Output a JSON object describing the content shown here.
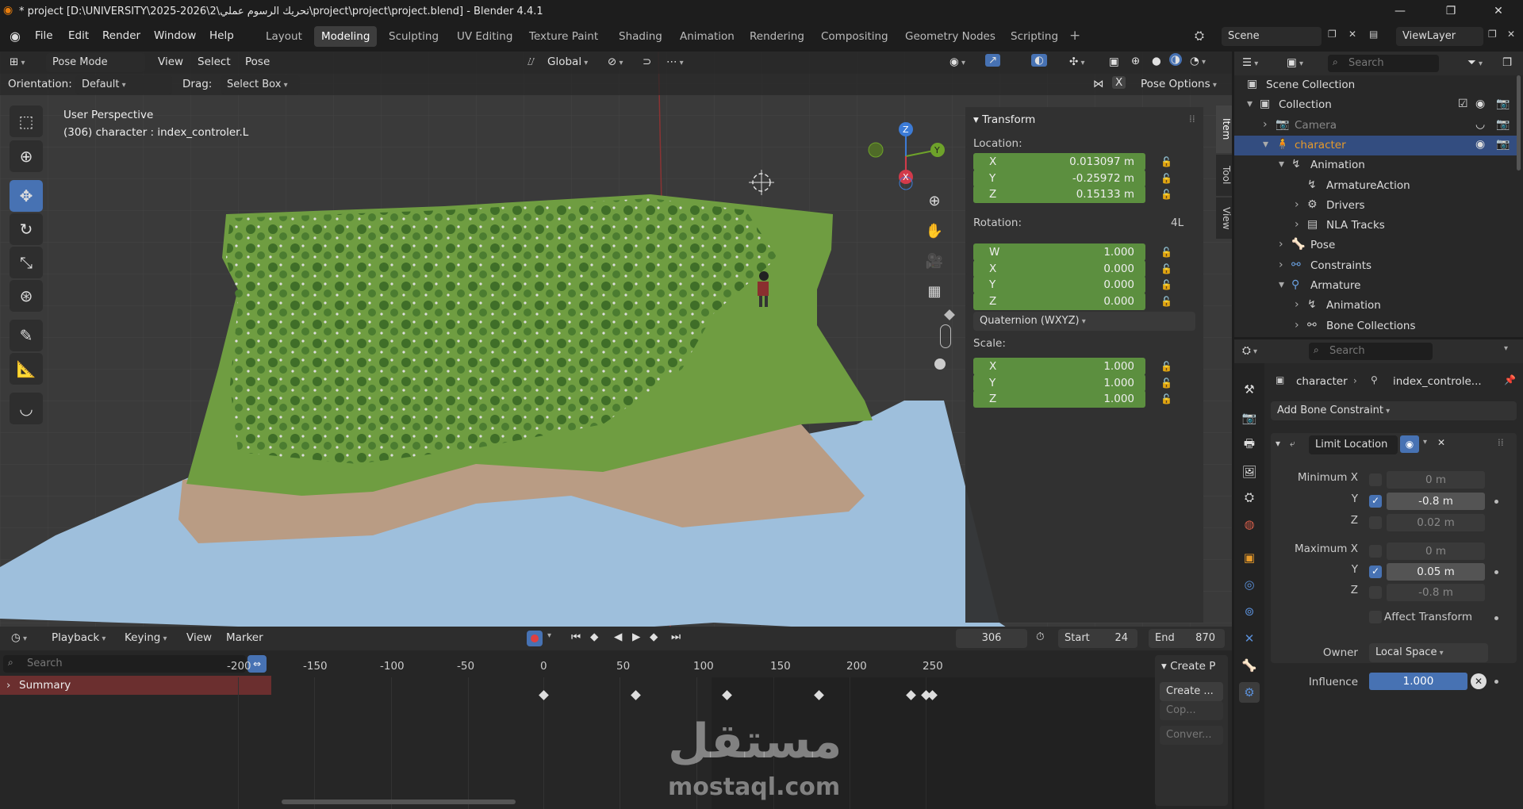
{
  "window": {
    "title": "* project [D:\\UNIVERSITY\\2025-2026\\2\\تحريك الرسوم عملي\\project\\project\\project.blend] - Blender 4.4.1"
  },
  "menu": {
    "file": "File",
    "edit": "Edit",
    "render": "Render",
    "window": "Window",
    "help": "Help"
  },
  "workspaces": [
    "Layout",
    "Modeling",
    "Sculpting",
    "UV Editing",
    "Texture Paint",
    "Shading",
    "Animation",
    "Rendering",
    "Compositing",
    "Geometry Nodes",
    "Scripting"
  ],
  "active_workspace": "Modeling",
  "scene": {
    "name": "Scene",
    "view_layer": "ViewLayer"
  },
  "viewport": {
    "mode": "Pose Mode",
    "view": "View",
    "select": "Select",
    "pose": "Pose",
    "transform_orientation": "Global",
    "orientation_label": "Orientation:",
    "orientation_value": "Default",
    "drag_label": "Drag:",
    "drag_value": "Select Box",
    "pose_options": "Pose Options",
    "x_mirror": "X",
    "perspective": "User Perspective",
    "object_info": "(306) character : index_controler.L",
    "axes": {
      "x": "X",
      "y": "Y",
      "z": "Z"
    },
    "tabs": [
      "Item",
      "Tool",
      "View"
    ]
  },
  "transform": {
    "title": "Transform",
    "location_label": "Location:",
    "location": [
      {
        "k": "X",
        "v": "0.013097 m"
      },
      {
        "k": "Y",
        "v": "-0.25972 m"
      },
      {
        "k": "Z",
        "v": "0.15133 m"
      }
    ],
    "rotation_label": "Rotation:",
    "rotation_mode_short": "4L",
    "rotation": [
      {
        "k": "W",
        "v": "1.000"
      },
      {
        "k": "X",
        "v": "0.000"
      },
      {
        "k": "Y",
        "v": "0.000"
      },
      {
        "k": "Z",
        "v": "0.000"
      }
    ],
    "rotation_mode": "Quaternion (WXYZ)",
    "scale_label": "Scale:",
    "scale": [
      {
        "k": "X",
        "v": "1.000"
      },
      {
        "k": "Y",
        "v": "1.000"
      },
      {
        "k": "Z",
        "v": "1.000"
      }
    ]
  },
  "timeline": {
    "playback": "Playback",
    "keying": "Keying",
    "view": "View",
    "marker": "Marker",
    "current_frame": "306",
    "start_label": "Start",
    "start": "24",
    "end_label": "End",
    "end": "870",
    "search_placeholder": "Search",
    "summary": "Summary",
    "ticks": [
      "-200",
      "-150",
      "-100",
      "-50",
      "0",
      "50",
      "100",
      "150",
      "200",
      "250"
    ],
    "create_panel": "Create P",
    "create_btn": "Create ...",
    "copy_btn": "Cop...",
    "convert_btn": "Conver..."
  },
  "outliner": {
    "search_placeholder": "Search",
    "rows": [
      "Scene Collection",
      "Collection",
      "Camera",
      "character",
      "Animation",
      "ArmatureAction",
      "Drivers",
      "NLA Tracks",
      "Pose",
      "Constraints",
      "Armature",
      "Animation",
      "Bone Collections"
    ]
  },
  "properties": {
    "search_placeholder": "Search",
    "breadcrumb_object": "character",
    "breadcrumb_bone": "index_controle...",
    "add_constraint": "Add Bone Constraint",
    "constraint_name": "Limit Location",
    "min_x_label": "Minimum X",
    "y_label": "Y",
    "z_label": "Z",
    "max_x_label": "Maximum X",
    "min_x": "0 m",
    "min_y": "-0.8 m",
    "min_z": "0.02 m",
    "max_x": "0 m",
    "max_y": "0.05 m",
    "max_z": "-0.8 m",
    "affect_transform": "Affect Transform",
    "owner_label": "Owner",
    "owner_value": "Local Space",
    "influence_label": "Influence",
    "influence_value": "1.000",
    "influence": 1.0
  },
  "watermark": {
    "arabic": "مستقل",
    "latin": "mostaql.com"
  },
  "colors": {
    "accent": "#4772b3",
    "field_green": "#5c8f3f",
    "selected_row": "#334d80",
    "keyframe_summary": "#6b2f2f"
  }
}
